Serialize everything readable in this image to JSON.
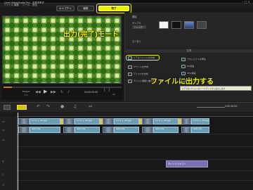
{
  "window": {
    "title": "Corel VideoStudio Pro - 名称未設定"
  },
  "menu": [
    "ファイル",
    "編集",
    "ツール",
    "設定"
  ],
  "mode_tabs": [
    "キャプチャ",
    "編集",
    "完了"
  ],
  "annotations": {
    "output_mode": "出力(完了)モード",
    "file_output": "ファイルに出力する"
  },
  "library": {
    "items": [
      "追加",
      "サンプル",
      "フォルダー"
    ],
    "sort_label": "並べ替え"
  },
  "share": {
    "header": "共有",
    "items": [
      "ビデオファイルを作成",
      "サウンドを作成",
      "ディスクを作成",
      "モバイル機器に書き出し",
      "プロジェクトを再生",
      "DV録画",
      "HDV録画",
      "Webに書き出し"
    ],
    "tooltip": "ビデオをパソコンのハードディスクに出力します"
  },
  "player": {
    "project_label": "Project",
    "clip_label": "Clip",
    "timecode": "00:00:00:00"
  },
  "timeline": {
    "overlay_clip": "タイトルテキスト",
    "clips_top": [
      "1フォト_01.jpg",
      "1フォト_02.jpg",
      "1フォト_03.jpg",
      "1フォト_04.jpg",
      "1フォト_05.jpg"
    ],
    "clips_video": [
      "001.mts",
      "002.mts",
      "003.mts",
      "004.mts",
      "005.mts"
    ],
    "time_readout": "0:00:30:00"
  },
  "colors": {
    "accent": "#f0f000",
    "clip": "#6a9bb0",
    "preview_green": "#4f8a2a"
  }
}
